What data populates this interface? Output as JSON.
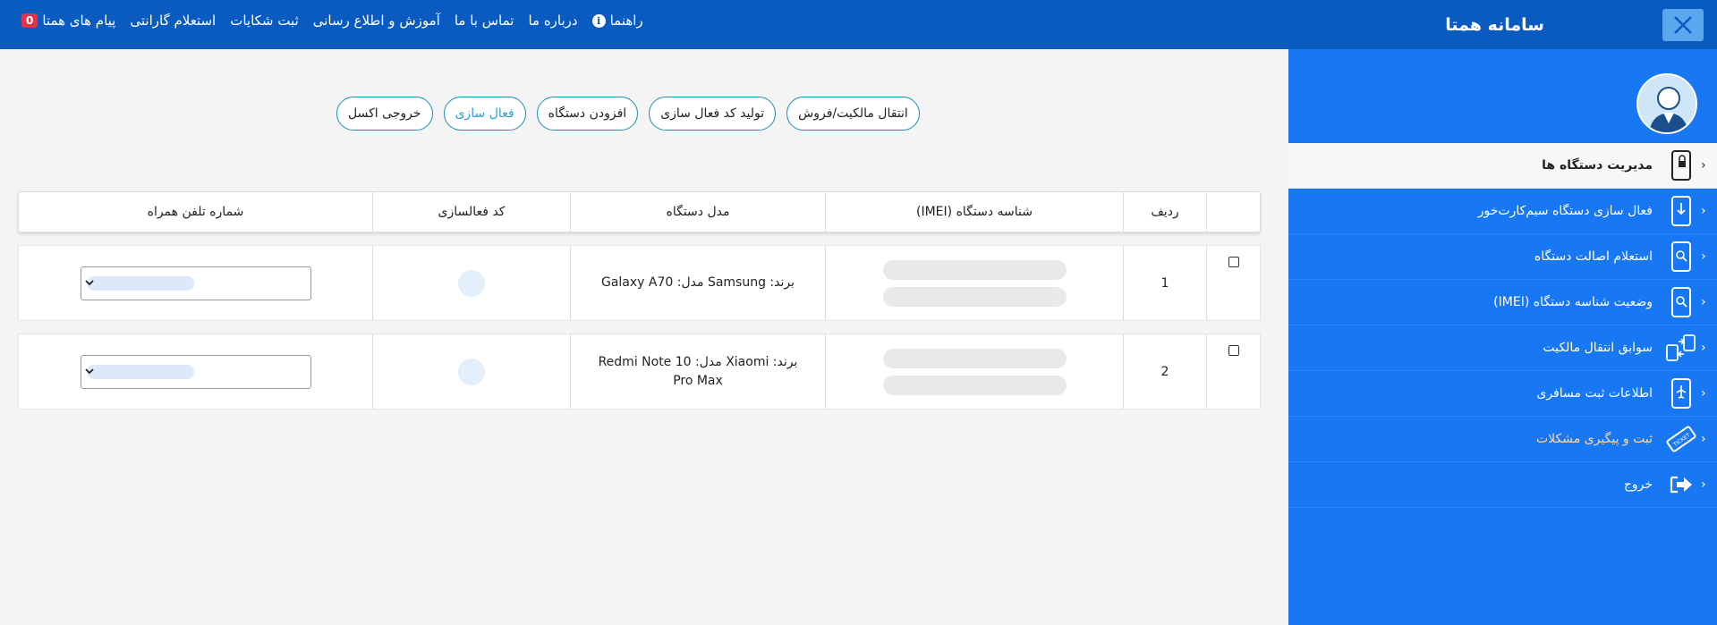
{
  "header": {
    "title": "سامانه همتا",
    "nav": [
      {
        "label": "پیام های همتا",
        "badge": "0"
      },
      {
        "label": "استعلام گارانتی"
      },
      {
        "label": "ثبت شکایات"
      },
      {
        "label": "آموزش و اطلاع رسانی"
      },
      {
        "label": "تماس با ما"
      },
      {
        "label": "درباره ما"
      },
      {
        "label": "راهنما",
        "icon": "info-icon"
      }
    ]
  },
  "sidebar": {
    "items": [
      {
        "label": "مدیریت دستگاه ها",
        "icon": "phone-lock-icon",
        "active": true
      },
      {
        "label": "فعال سازی دستگاه سیم‌کارت‌خور",
        "icon": "phone-arrow-icon"
      },
      {
        "label": "استعلام اصالت دستگاه",
        "icon": "phone-search-icon"
      },
      {
        "label": "وضعیت شناسه دستگاه (IMEI)",
        "icon": "phone-search-icon"
      },
      {
        "label": "سوابق انتقال مالکیت",
        "icon": "transfer-icon"
      },
      {
        "label": "اطلاعات ثبت مسافری",
        "icon": "phone-plane-icon"
      },
      {
        "label": "ثبت و پیگیری مشکلات",
        "icon": "ticket-icon"
      },
      {
        "label": "خروج",
        "icon": "logout-icon"
      }
    ]
  },
  "toolbar": {
    "transfer": "انتقال مالکیت/فروش",
    "generate_code": "تولید کد فعال سازی",
    "add_device": "افزودن دستگاه",
    "activate": "فعال سازی",
    "excel": "خروجی اکسل"
  },
  "table": {
    "headers": {
      "index": "ردیف",
      "imei": "شناسه دستگاه (IMEI)",
      "model": "مدل دستگاه",
      "code": "کد فعالسازی",
      "phone": "شماره تلفن همراه"
    },
    "rows": [
      {
        "index": "1",
        "model": "برند: Samsung مدل: Galaxy A70"
      },
      {
        "index": "2",
        "model": "برند: Xiaomi مدل: Redmi Note 10 Pro Max"
      }
    ]
  },
  "colors": {
    "topbar": "#0a5bc0",
    "sidebar": "#1877f2",
    "accent": "#1d8fb0"
  }
}
